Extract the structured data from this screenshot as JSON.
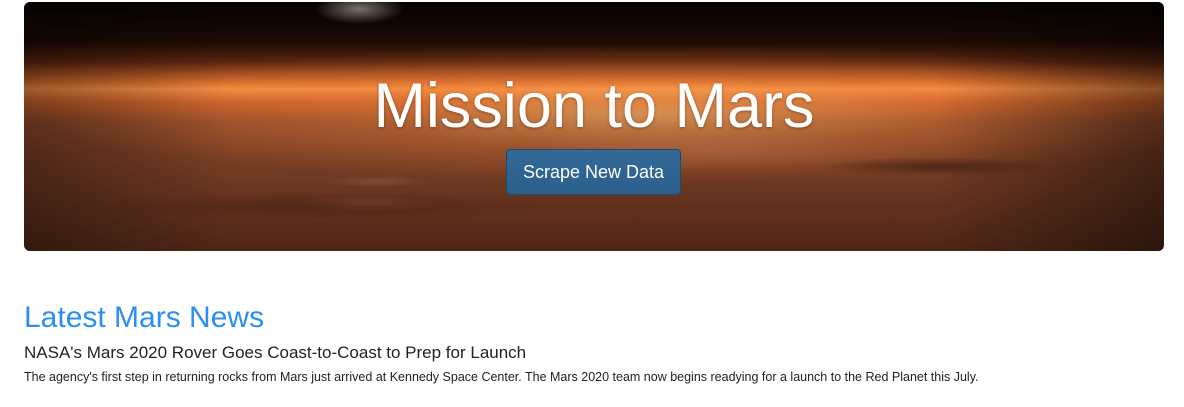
{
  "hero": {
    "title": "Mission to Mars",
    "button_label": "Scrape New Data"
  },
  "news": {
    "heading": "Latest Mars News",
    "title": "NASA's Mars 2020 Rover Goes Coast-to-Coast to Prep for Launch",
    "paragraph": "The agency's first step in returning rocks from Mars just arrived at Kennedy Space Center. The Mars 2020 team now begins readying for a launch to the Red Planet this July."
  },
  "colors": {
    "heading_blue": "#2b8ef2",
    "button_blue": "#2b5e8b",
    "text": "#222222"
  }
}
